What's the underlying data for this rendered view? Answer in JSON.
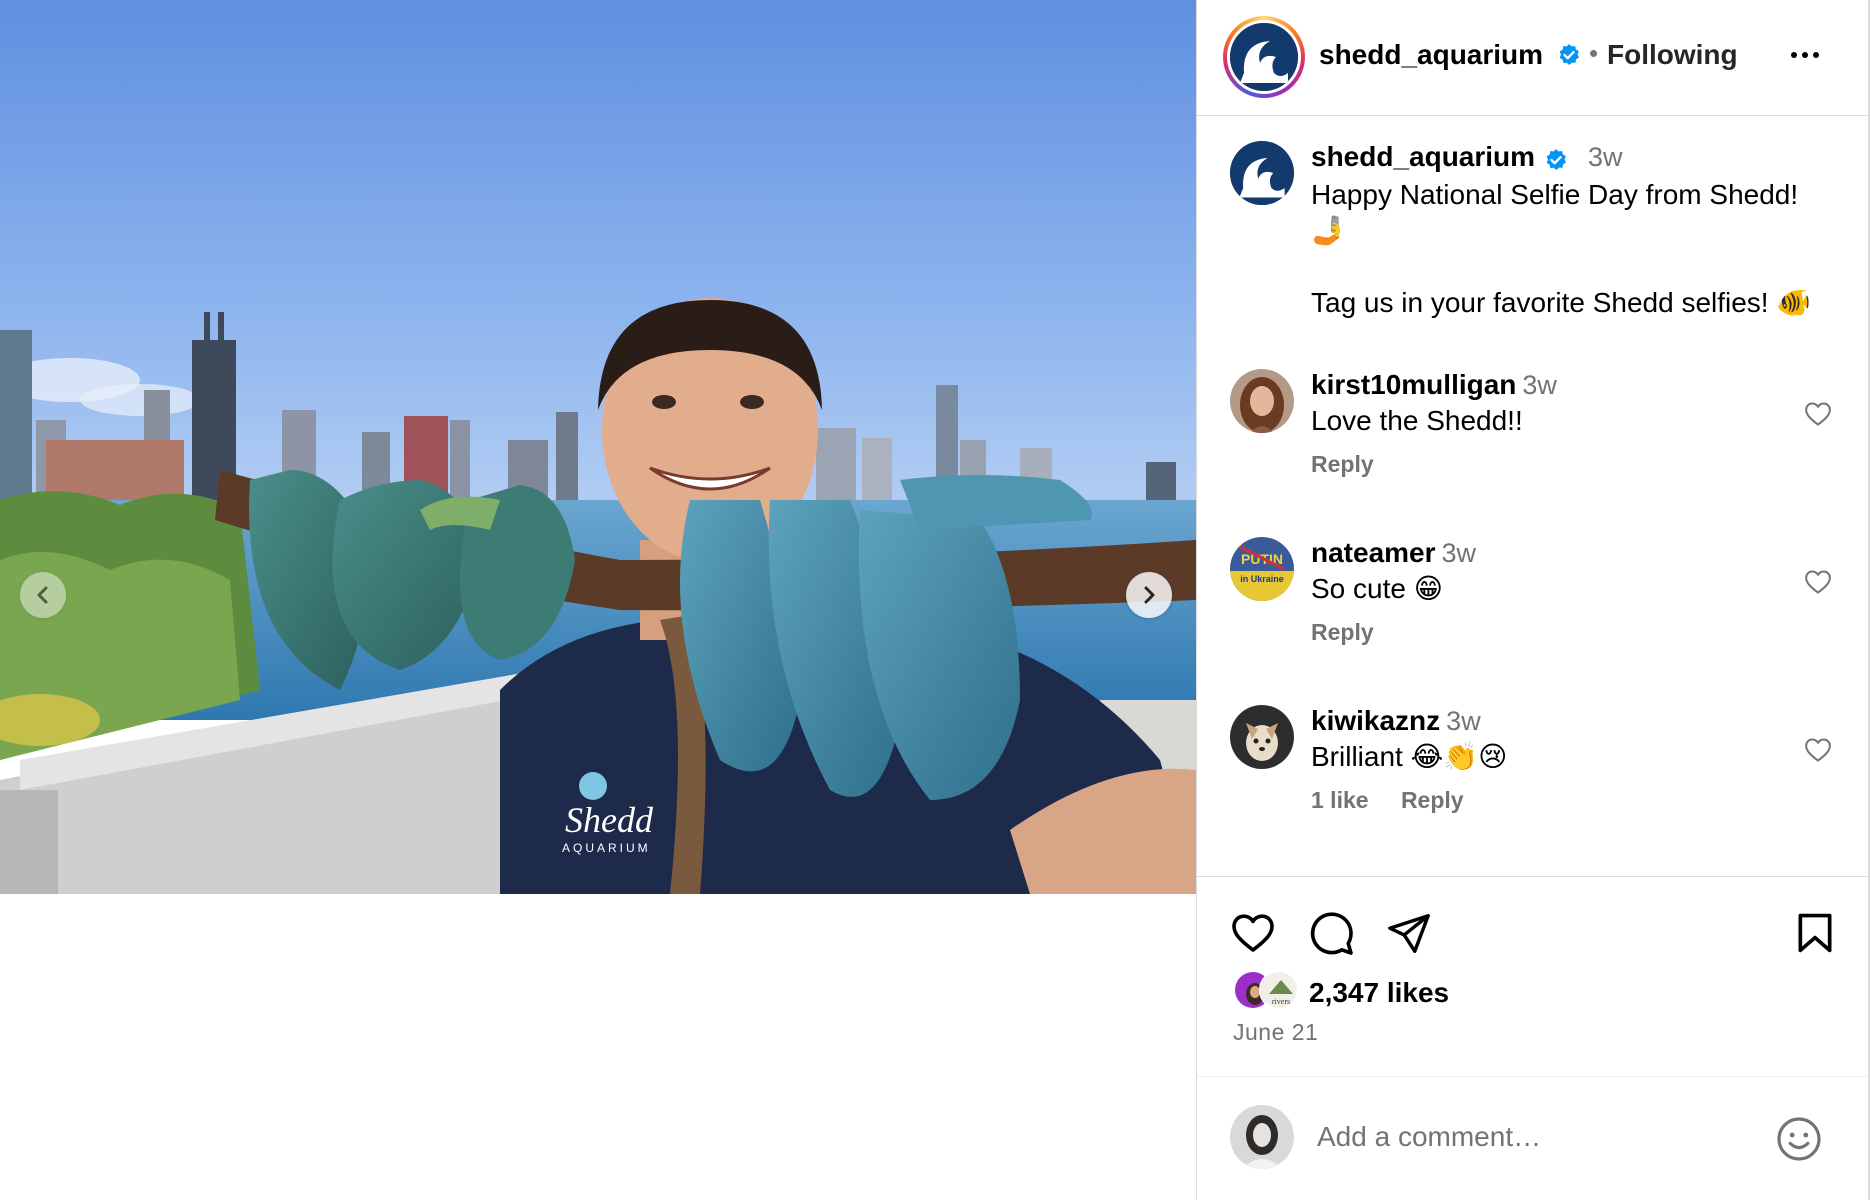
{
  "post": {
    "username": "shedd_aquarium",
    "follow_status": "Following",
    "separator": "•"
  },
  "caption": {
    "username": "shedd_aquarium",
    "time": "3w",
    "line1": "Happy National Selfie Day from Shedd!",
    "line1_emoji": "🤳",
    "line2": "Tag us in your favorite Shedd selfies!",
    "line2_emoji": "🐠"
  },
  "comments": [
    {
      "username": "kirst10mulligan",
      "time": "3w",
      "text": "Love the Shedd!!",
      "likes": "",
      "reply": "Reply"
    },
    {
      "username": "nateamer",
      "time": "3w",
      "text": "So cute 😁",
      "likes": "",
      "reply": "Reply"
    },
    {
      "username": "kiwikaznz",
      "time": "3w",
      "text": "Brilliant 😂👏😢",
      "likes": "1 like",
      "reply": "Reply"
    }
  ],
  "avatar_labels": {
    "nateamer_top": "PUTIN",
    "nateamer_bottom": "in Ukraine",
    "liker2": "rivers"
  },
  "media_logo": {
    "brand": "Shedd",
    "sub": "AQUARIUM"
  },
  "engagement": {
    "likes": "2,347 likes",
    "date": "June 21"
  },
  "add_comment": {
    "placeholder": "Add a comment…"
  },
  "icons": {
    "carousel_prev": "chevron-left-icon",
    "carousel_next": "chevron-right-icon",
    "like": "heart-icon",
    "comment": "speech-bubble-icon",
    "share": "paper-plane-icon",
    "save": "bookmark-icon",
    "more": "more-options-icon",
    "emoji": "smiley-icon",
    "verified": "verified-badge-icon"
  },
  "colors": {
    "verified_blue": "#0095f6",
    "secondary_text": "#737373",
    "border": "#dbdbdb",
    "brand_navy": "#123a6d"
  }
}
